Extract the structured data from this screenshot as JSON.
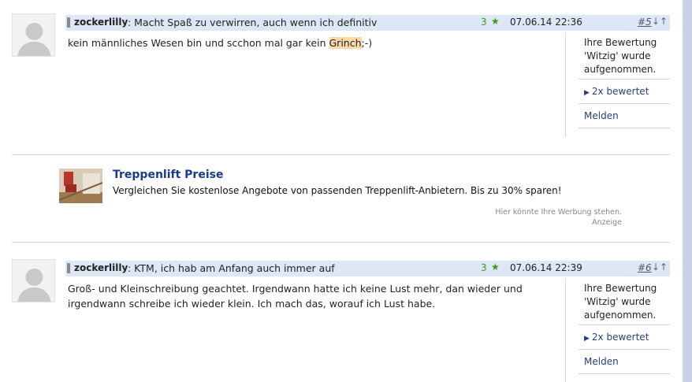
{
  "posts": [
    {
      "author": "zockerlilly",
      "title": ": Macht Spaß zu verwirren, auch wenn ich definitiv",
      "rating": "3",
      "star": "★",
      "date": "07.06.14 22:36",
      "number": "#5",
      "arrows": "↓↑",
      "body_before": "kein männliches Wesen bin und scchon mal gar kein ",
      "body_highlight": "Grinch",
      "body_after": ";-)",
      "side_message": "Ihre Bewertung 'Witzig' wurde aufgenommen.",
      "rated_label": "2x bewertet",
      "report_label": "Melden"
    },
    {
      "author": "zockerlilly",
      "title": ": KTM, ich hab am Anfang auch immer auf",
      "rating": "3",
      "star": "★",
      "date": "07.06.14 22:39",
      "number": "#6",
      "arrows": "↓↑",
      "body": "Groß- und Kleinschreibung geachtet. Irgendwann hatte ich keine Lust mehr, dan wieder und irgendwann schreibe ich wieder klein. Ich mach das, worauf ich Lust habe.",
      "side_message": "Ihre Bewertung 'Witzig' wurde aufgenommen.",
      "rated_label": "2x bewertet",
      "report_label": "Melden"
    }
  ],
  "ad": {
    "title": "Treppenlift Preise",
    "text": "Vergleichen Sie kostenlose Angebote von passenden Treppenlift-Anbietern. Bis zu 30% sparen!",
    "note_line1": "Hier könnte Ihre Werbung stehen.",
    "note_line2": "Anzeige"
  },
  "colors": {
    "header_bg": "#dde7f6",
    "rating_green": "#3a9a1a",
    "link_blue": "#2a3f78",
    "ad_title": "#1a3a8a",
    "highlight": "#fcd8a8"
  }
}
